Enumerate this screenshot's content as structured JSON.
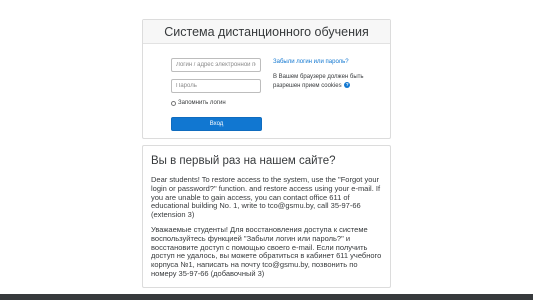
{
  "login": {
    "title": "Система дистанционного обучения",
    "username_placeholder": "Логин / адрес электронной почты",
    "password_placeholder": "Пароль",
    "remember_label": "Запомнить логин",
    "submit_label": "Вход",
    "forgot_link": "Забыли логин или пароль?",
    "cookies_text": "В Вашем браузере должен быть разрешен прием cookies",
    "help_icon": "?"
  },
  "info": {
    "title": "Вы в первый раз на нашем сайте?",
    "paragraph_en": "Dear students! To restore access to the system, use the \"Forgot your login or password?\" function. and restore access using your e-mail. If you are unable to gain access, you can contact office 611 of educational building No. 1, write to tco@gsmu.by, call 35-97-66 (extension 3)",
    "paragraph_ru": "Уважаемые студенты! Для восстановления доступа к системе воспользуйтесь функцией \"Забыли логин или пароль?\" и восстановите доступ с помощью своего e-mail. Если получить доступ не удалось, вы можете обратиться в кабинет 611 учебного корпуса №1, написать на почту tco@gsmu.by, позвонить по номеру 35-97-66 (добавочный 3)"
  },
  "colors": {
    "accent": "#1177d1",
    "footer": "#373a3c"
  }
}
